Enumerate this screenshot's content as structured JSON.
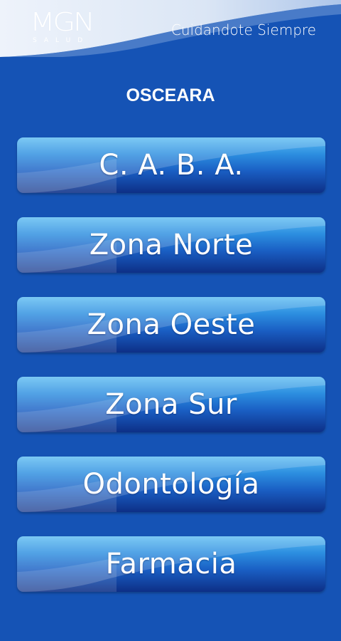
{
  "header": {
    "logo_text": "MGN",
    "logo_subtext": "SALUD",
    "tagline": "Cuidandote Siempre"
  },
  "page": {
    "title": "OSCEARA"
  },
  "menu": {
    "items": [
      {
        "label": "C. A. B. A."
      },
      {
        "label": "Zona Norte"
      },
      {
        "label": "Zona Oeste"
      },
      {
        "label": "Zona Sur"
      },
      {
        "label": "Odontología"
      },
      {
        "label": "Farmacia"
      }
    ]
  },
  "colors": {
    "background": "#1553b5",
    "header_swoosh": "#dbe6f5",
    "button_top": "#5fbdf2",
    "button_bottom": "#0d2f86",
    "text": "#ffffff"
  }
}
